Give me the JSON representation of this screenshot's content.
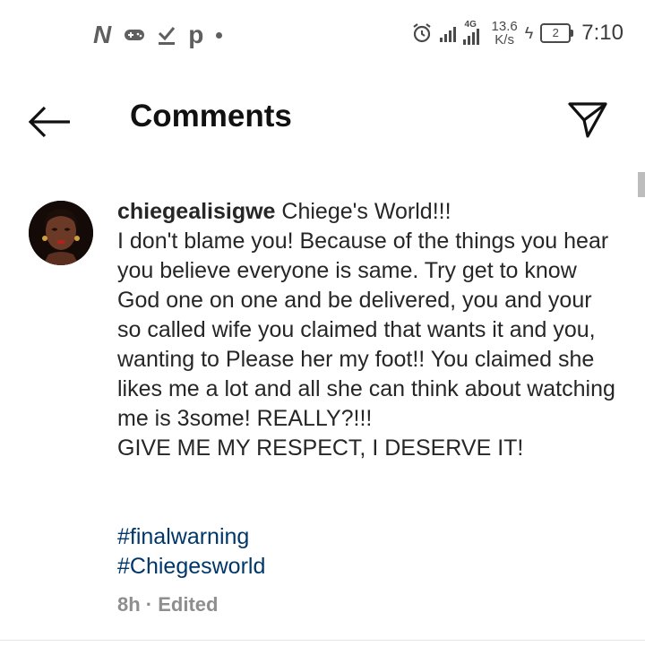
{
  "status_bar": {
    "left_icons": [
      "n-app-icon",
      "gamepad-icon",
      "check-download-icon",
      "p-app-icon",
      "dot-icon"
    ],
    "network": "4G",
    "speed_value": "13.6",
    "speed_unit": "K/s",
    "battery_level": "2",
    "time": "7:10"
  },
  "header": {
    "title": "Comments"
  },
  "comment": {
    "username": "chiegealisigwe",
    "text": "Chiege's World!!!\nI don't blame you! Because of the things you hear you believe everyone is same. Try get to know God one on one and be delivered, you and your so called wife you claimed that wants it and you, wanting to Please her my foot!! You claimed she likes me a lot and all she can think about watching me is 3some! REALLY?!!!\nGIVE ME MY RESPECT, I DESERVE IT!",
    "hashtags": [
      "#finalwarning",
      "#Chiegesworld"
    ],
    "time_ago": "8h",
    "separator": " · ",
    "edited_label": "Edited"
  },
  "colors": {
    "hashtag": "#00376b",
    "meta": "#8e8e8e",
    "text": "#262626"
  }
}
